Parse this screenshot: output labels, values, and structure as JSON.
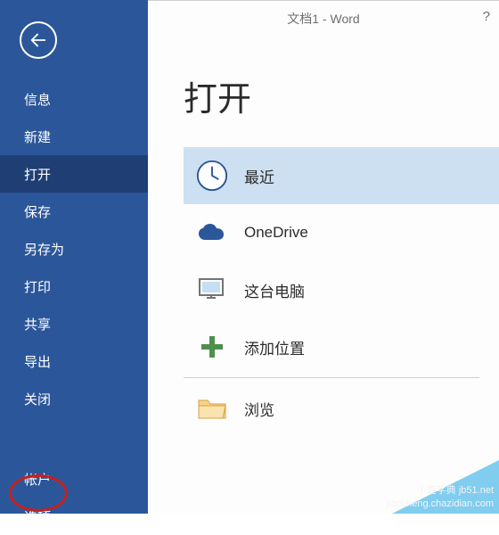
{
  "titlebar": {
    "docTitle": "文档1 - Word",
    "help": "?"
  },
  "sidebar": {
    "items": [
      {
        "label": "信息"
      },
      {
        "label": "新建"
      },
      {
        "label": "打开"
      },
      {
        "label": "保存"
      },
      {
        "label": "另存为"
      },
      {
        "label": "打印"
      },
      {
        "label": "共享"
      },
      {
        "label": "导出"
      },
      {
        "label": "关闭"
      }
    ],
    "bottomItems": [
      {
        "label": "帐户"
      },
      {
        "label": "选项"
      }
    ]
  },
  "main": {
    "pageTitle": "打开",
    "sources": {
      "recent": "最近",
      "onedrive": "OneDrive",
      "thispc": "这台电脑",
      "addplace": "添加位置",
      "browse": "浏览"
    }
  },
  "watermark": {
    "line1": "小查字典 jb51.net",
    "line2": "jiaocheng.chazidian.com"
  }
}
